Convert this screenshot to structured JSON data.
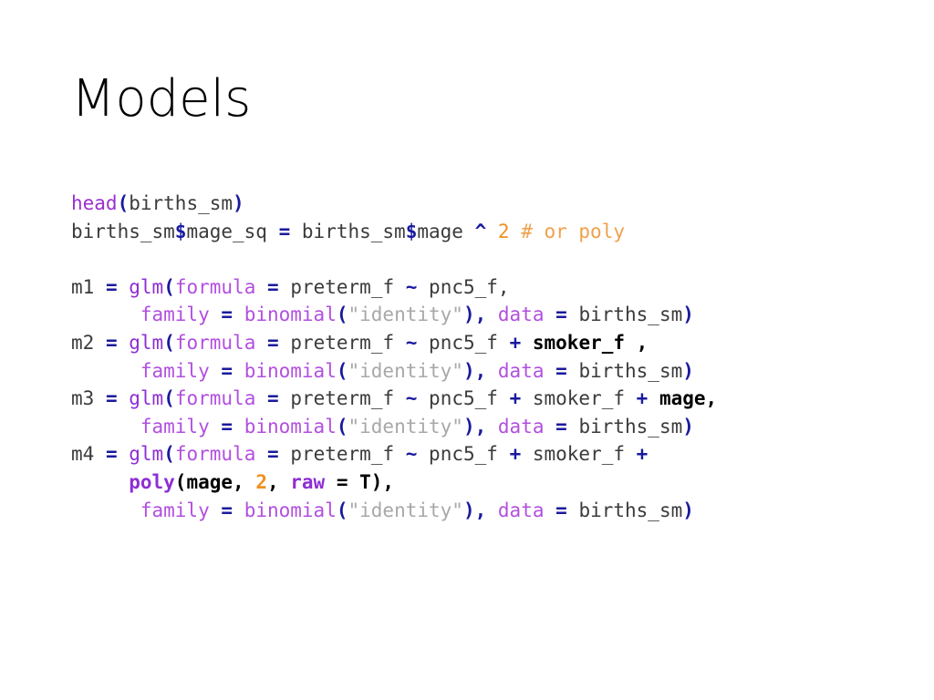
{
  "slide": {
    "title": "Models",
    "background": "#ffffff"
  },
  "colors": {
    "plain": "#3b3b3b",
    "function": "#9b30d0",
    "argument": "#b24fe0",
    "operator": "#1a1a9e",
    "string": "#a8a8a8",
    "number": "#f0901e",
    "comment": "#f0a04b",
    "highlight": "#000000"
  },
  "code": {
    "language": "R",
    "lines": [
      {
        "id": "line-head",
        "tokens": [
          {
            "text": "head",
            "style": "t-fn"
          },
          {
            "text": "(",
            "style": "t-op"
          },
          {
            "text": "births_sm",
            "style": "t-plain"
          },
          {
            "text": ")",
            "style": "t-op"
          }
        ]
      },
      {
        "id": "line-mage-sq",
        "tokens": [
          {
            "text": "births_sm",
            "style": "t-plain"
          },
          {
            "text": "$",
            "style": "t-op"
          },
          {
            "text": "mage_sq ",
            "style": "t-plain"
          },
          {
            "text": "=",
            "style": "t-op"
          },
          {
            "text": " births_sm",
            "style": "t-plain"
          },
          {
            "text": "$",
            "style": "t-op"
          },
          {
            "text": "mage ",
            "style": "t-plain"
          },
          {
            "text": "^",
            "style": "t-op"
          },
          {
            "text": " ",
            "style": "t-plain"
          },
          {
            "text": "2",
            "style": "t-num"
          },
          {
            "text": " ",
            "style": "t-plain"
          },
          {
            "text": "# or poly",
            "style": "t-comment"
          }
        ]
      },
      {
        "id": "line-blank-1",
        "tokens": []
      },
      {
        "id": "line-m1-a",
        "tokens": [
          {
            "text": "m1 ",
            "style": "t-plain"
          },
          {
            "text": "=",
            "style": "t-op"
          },
          {
            "text": " ",
            "style": "t-plain"
          },
          {
            "text": "glm",
            "style": "t-fn2"
          },
          {
            "text": "(",
            "style": "t-op"
          },
          {
            "text": "formula",
            "style": "t-arg"
          },
          {
            "text": " ",
            "style": "t-plain"
          },
          {
            "text": "=",
            "style": "t-op"
          },
          {
            "text": " preterm_f ",
            "style": "t-plain"
          },
          {
            "text": "~",
            "style": "t-op"
          },
          {
            "text": " pnc5_f,",
            "style": "t-plain"
          }
        ]
      },
      {
        "id": "line-m1-b",
        "tokens": [
          {
            "text": "      ",
            "style": "t-plain"
          },
          {
            "text": "family",
            "style": "t-arg"
          },
          {
            "text": " ",
            "style": "t-plain"
          },
          {
            "text": "=",
            "style": "t-op"
          },
          {
            "text": " ",
            "style": "t-plain"
          },
          {
            "text": "binomial",
            "style": "t-arg"
          },
          {
            "text": "(",
            "style": "t-op"
          },
          {
            "text": "\"identity\"",
            "style": "t-str"
          },
          {
            "text": ")",
            "style": "t-op"
          },
          {
            "text": ",",
            "style": "t-op"
          },
          {
            "text": " ",
            "style": "t-plain"
          },
          {
            "text": "data",
            "style": "t-arg"
          },
          {
            "text": " ",
            "style": "t-plain"
          },
          {
            "text": "=",
            "style": "t-op"
          },
          {
            "text": " births_sm",
            "style": "t-plain"
          },
          {
            "text": ")",
            "style": "t-op"
          }
        ]
      },
      {
        "id": "line-m2-a",
        "tokens": [
          {
            "text": "m2 ",
            "style": "t-plain"
          },
          {
            "text": "=",
            "style": "t-op"
          },
          {
            "text": " ",
            "style": "t-plain"
          },
          {
            "text": "glm",
            "style": "t-fn2"
          },
          {
            "text": "(",
            "style": "t-op"
          },
          {
            "text": "formula",
            "style": "t-arg"
          },
          {
            "text": " ",
            "style": "t-plain"
          },
          {
            "text": "=",
            "style": "t-op"
          },
          {
            "text": " preterm_f ",
            "style": "t-plain"
          },
          {
            "text": "~",
            "style": "t-op"
          },
          {
            "text": " pnc5_f ",
            "style": "t-plain"
          },
          {
            "text": "+",
            "style": "t-boldop"
          },
          {
            "text": " ",
            "style": "t-plain"
          },
          {
            "text": "smoker_f ,",
            "style": "t-bold"
          }
        ]
      },
      {
        "id": "line-m2-b",
        "tokens": [
          {
            "text": "      ",
            "style": "t-plain"
          },
          {
            "text": "family",
            "style": "t-arg"
          },
          {
            "text": " ",
            "style": "t-plain"
          },
          {
            "text": "=",
            "style": "t-op"
          },
          {
            "text": " ",
            "style": "t-plain"
          },
          {
            "text": "binomial",
            "style": "t-arg"
          },
          {
            "text": "(",
            "style": "t-op"
          },
          {
            "text": "\"identity\"",
            "style": "t-str"
          },
          {
            "text": ")",
            "style": "t-op"
          },
          {
            "text": ",",
            "style": "t-op"
          },
          {
            "text": " ",
            "style": "t-plain"
          },
          {
            "text": "data",
            "style": "t-arg"
          },
          {
            "text": " ",
            "style": "t-plain"
          },
          {
            "text": "=",
            "style": "t-op"
          },
          {
            "text": " births_sm",
            "style": "t-plain"
          },
          {
            "text": ")",
            "style": "t-op"
          }
        ]
      },
      {
        "id": "line-m3-a",
        "tokens": [
          {
            "text": "m3 ",
            "style": "t-plain"
          },
          {
            "text": "=",
            "style": "t-op"
          },
          {
            "text": " ",
            "style": "t-plain"
          },
          {
            "text": "glm",
            "style": "t-fn2"
          },
          {
            "text": "(",
            "style": "t-op"
          },
          {
            "text": "formula",
            "style": "t-arg"
          },
          {
            "text": " ",
            "style": "t-plain"
          },
          {
            "text": "=",
            "style": "t-op"
          },
          {
            "text": " preterm_f ",
            "style": "t-plain"
          },
          {
            "text": "~",
            "style": "t-op"
          },
          {
            "text": " pnc5_f ",
            "style": "t-plain"
          },
          {
            "text": "+",
            "style": "t-boldop"
          },
          {
            "text": " smoker_f ",
            "style": "t-plain"
          },
          {
            "text": "+",
            "style": "t-boldop"
          },
          {
            "text": " ",
            "style": "t-plain"
          },
          {
            "text": "mage,",
            "style": "t-bold"
          }
        ]
      },
      {
        "id": "line-m3-b",
        "tokens": [
          {
            "text": "      ",
            "style": "t-plain"
          },
          {
            "text": "family",
            "style": "t-arg"
          },
          {
            "text": " ",
            "style": "t-plain"
          },
          {
            "text": "=",
            "style": "t-op"
          },
          {
            "text": " ",
            "style": "t-plain"
          },
          {
            "text": "binomial",
            "style": "t-arg"
          },
          {
            "text": "(",
            "style": "t-op"
          },
          {
            "text": "\"identity\"",
            "style": "t-str"
          },
          {
            "text": ")",
            "style": "t-op"
          },
          {
            "text": ",",
            "style": "t-op"
          },
          {
            "text": " ",
            "style": "t-plain"
          },
          {
            "text": "data",
            "style": "t-arg"
          },
          {
            "text": " ",
            "style": "t-plain"
          },
          {
            "text": "=",
            "style": "t-op"
          },
          {
            "text": " births_sm",
            "style": "t-plain"
          },
          {
            "text": ")",
            "style": "t-op"
          }
        ]
      },
      {
        "id": "line-m4-a",
        "tokens": [
          {
            "text": "m4 ",
            "style": "t-plain"
          },
          {
            "text": "=",
            "style": "t-op"
          },
          {
            "text": " ",
            "style": "t-plain"
          },
          {
            "text": "glm",
            "style": "t-fn2"
          },
          {
            "text": "(",
            "style": "t-op"
          },
          {
            "text": "formula",
            "style": "t-arg"
          },
          {
            "text": " ",
            "style": "t-plain"
          },
          {
            "text": "=",
            "style": "t-op"
          },
          {
            "text": " preterm_f ",
            "style": "t-plain"
          },
          {
            "text": "~",
            "style": "t-op"
          },
          {
            "text": " pnc5_f ",
            "style": "t-plain"
          },
          {
            "text": "+",
            "style": "t-boldop"
          },
          {
            "text": " smoker_f ",
            "style": "t-plain"
          },
          {
            "text": "+",
            "style": "t-boldop"
          }
        ]
      },
      {
        "id": "line-m4-poly",
        "tokens": [
          {
            "text": "     ",
            "style": "t-plain"
          },
          {
            "text": "poly",
            "style": "t-boldfn"
          },
          {
            "text": "(mage, ",
            "style": "t-bold"
          },
          {
            "text": "2",
            "style": "t-boldnum"
          },
          {
            "text": ", ",
            "style": "t-bold"
          },
          {
            "text": "raw",
            "style": "t-boldfn"
          },
          {
            "text": " = T),",
            "style": "t-bold"
          }
        ]
      },
      {
        "id": "line-m4-b",
        "tokens": [
          {
            "text": "      ",
            "style": "t-plain"
          },
          {
            "text": "family",
            "style": "t-arg"
          },
          {
            "text": " ",
            "style": "t-plain"
          },
          {
            "text": "=",
            "style": "t-op"
          },
          {
            "text": " ",
            "style": "t-plain"
          },
          {
            "text": "binomial",
            "style": "t-arg"
          },
          {
            "text": "(",
            "style": "t-op"
          },
          {
            "text": "\"identity\"",
            "style": "t-str"
          },
          {
            "text": ")",
            "style": "t-op"
          },
          {
            "text": ",",
            "style": "t-op"
          },
          {
            "text": " ",
            "style": "t-plain"
          },
          {
            "text": "data",
            "style": "t-arg"
          },
          {
            "text": " ",
            "style": "t-plain"
          },
          {
            "text": "=",
            "style": "t-op"
          },
          {
            "text": " births_sm",
            "style": "t-plain"
          },
          {
            "text": ")",
            "style": "t-op"
          }
        ]
      }
    ]
  }
}
